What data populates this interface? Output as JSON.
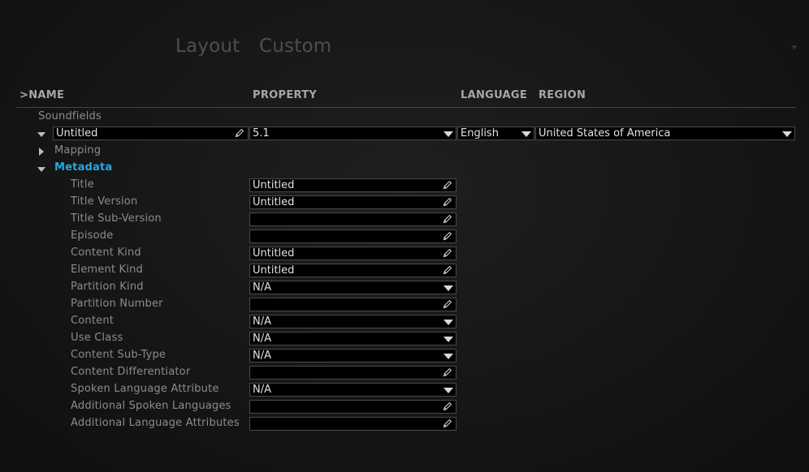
{
  "header": {
    "tabs": [
      "Layout",
      "Custom"
    ]
  },
  "columns": {
    "name": ">NAME",
    "property": "PROPERTY",
    "language": "LANGUAGE",
    "region": "REGION"
  },
  "group": {
    "label": "Soundfields"
  },
  "soundfield_row": {
    "name": "Untitled",
    "property": "5.1",
    "language": "English",
    "region": "United States of America"
  },
  "sections": {
    "mapping": "Mapping",
    "metadata": "Metadata"
  },
  "metadata_fields": [
    {
      "label": "Title",
      "value": "Untitled",
      "control": "edit"
    },
    {
      "label": "Title Version",
      "value": "Untitled",
      "control": "edit"
    },
    {
      "label": "Title Sub-Version",
      "value": "",
      "control": "edit"
    },
    {
      "label": "Episode",
      "value": "",
      "control": "edit"
    },
    {
      "label": "Content Kind",
      "value": "Untitled",
      "control": "edit"
    },
    {
      "label": "Element Kind",
      "value": "Untitled",
      "control": "edit"
    },
    {
      "label": "Partition Kind",
      "value": "N/A",
      "control": "dropdown"
    },
    {
      "label": "Partition Number",
      "value": "",
      "control": "edit"
    },
    {
      "label": "Content",
      "value": "N/A",
      "control": "dropdown"
    },
    {
      "label": "Use Class",
      "value": "N/A",
      "control": "dropdown"
    },
    {
      "label": "Content Sub-Type",
      "value": "N/A",
      "control": "dropdown"
    },
    {
      "label": "Content Differentiator",
      "value": "",
      "control": "edit"
    },
    {
      "label": "Spoken Language Attribute",
      "value": "N/A",
      "control": "dropdown"
    },
    {
      "label": "Additional Spoken Languages",
      "value": "",
      "control": "edit"
    },
    {
      "label": "Additional Language Attributes",
      "value": "",
      "control": "edit"
    }
  ],
  "icons": {
    "edit": "pencil-icon",
    "dropdown": "dropdown-arrow-icon",
    "expanded": "expanded-triangle-icon",
    "collapsed": "collapsed-triangle-icon"
  },
  "colors": {
    "accent": "#29a6e0",
    "field_bg": "#000000",
    "field_border": "#4a4a4a",
    "field_text": "#e2e2e2",
    "label": "#8c8c8c"
  }
}
